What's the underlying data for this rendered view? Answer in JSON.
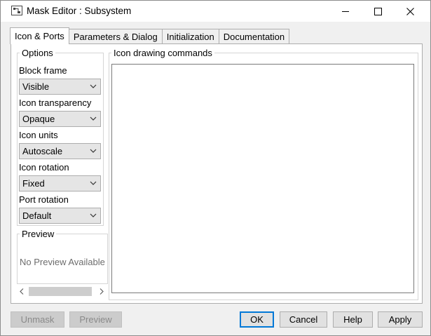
{
  "window": {
    "title": "Mask Editor : Subsystem"
  },
  "tabs": [
    {
      "label": "Icon & Ports",
      "active": true
    },
    {
      "label": "Parameters & Dialog",
      "active": false
    },
    {
      "label": "Initialization",
      "active": false
    },
    {
      "label": "Documentation",
      "active": false
    }
  ],
  "options": {
    "group_label": "Options",
    "fields": [
      {
        "label": "Block frame",
        "value": "Visible"
      },
      {
        "label": "Icon transparency",
        "value": "Opaque"
      },
      {
        "label": "Icon units",
        "value": "Autoscale"
      },
      {
        "label": "Icon rotation",
        "value": "Fixed"
      },
      {
        "label": "Port rotation",
        "value": "Default"
      }
    ]
  },
  "preview": {
    "group_label": "Preview",
    "message": "No Preview Available"
  },
  "drawing": {
    "group_label": "Icon drawing commands",
    "value": ""
  },
  "buttons": {
    "unmask": "Unmask",
    "preview": "Preview",
    "ok": "OK",
    "cancel": "Cancel",
    "help": "Help",
    "apply": "Apply"
  },
  "colors": {
    "focus_accent": "#0078d7",
    "panel_bg": "#f0f0f0"
  }
}
